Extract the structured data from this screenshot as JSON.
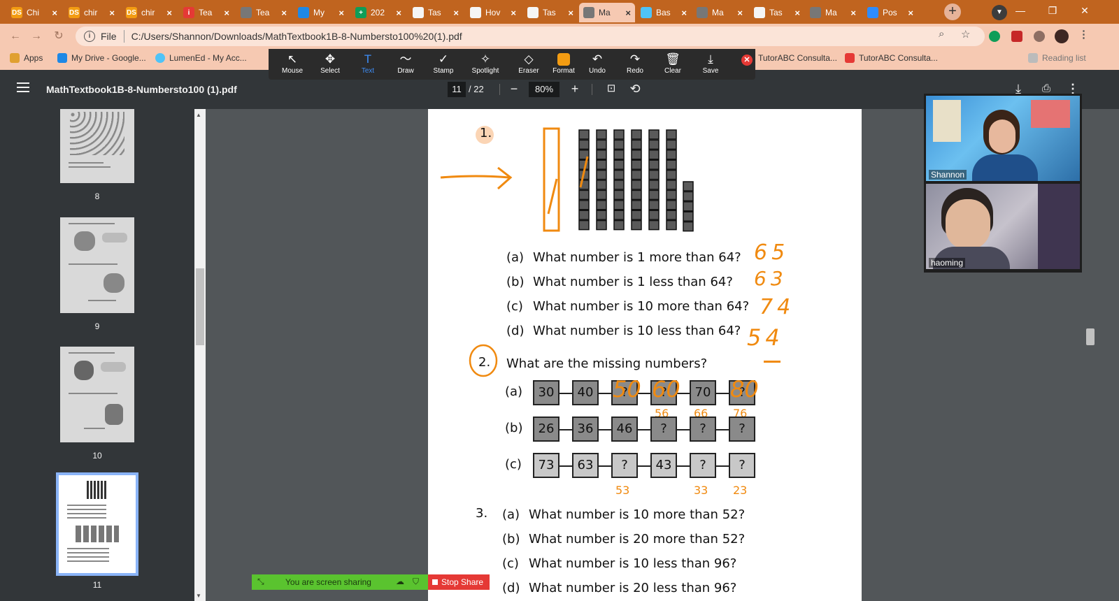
{
  "browser": {
    "tabs": [
      {
        "title": "Chi",
        "favicon_color": "#f39c12",
        "favicon": "DS",
        "active": false
      },
      {
        "title": "chir",
        "favicon_color": "#f39c12",
        "favicon": "DS",
        "active": false
      },
      {
        "title": "chir",
        "favicon_color": "#f39c12",
        "favicon": "DS",
        "active": false
      },
      {
        "title": "Tea",
        "favicon_color": "#e53935",
        "favicon": "i",
        "active": false
      },
      {
        "title": "Tea",
        "favicon_color": "#777777",
        "favicon": "",
        "active": false
      },
      {
        "title": "My",
        "favicon_color": "#1e88e5",
        "favicon": "",
        "active": false
      },
      {
        "title": "202",
        "favicon_color": "#0f9d58",
        "favicon": "+",
        "active": false
      },
      {
        "title": "Tas",
        "favicon_color": "#f5f5f5",
        "favicon": "",
        "active": false
      },
      {
        "title": "Hov",
        "favicon_color": "#f5f5f5",
        "favicon": "",
        "active": false
      },
      {
        "title": "Tas",
        "favicon_color": "#f5f5f5",
        "favicon": "",
        "active": false
      },
      {
        "title": "Ma",
        "favicon_color": "#777777",
        "favicon": "",
        "active": true
      },
      {
        "title": "Bas",
        "favicon_color": "#4fc3f7",
        "favicon": "",
        "active": false
      },
      {
        "title": "Ma",
        "favicon_color": "#777777",
        "favicon": "",
        "active": false
      },
      {
        "title": "Tas",
        "favicon_color": "#f5f5f5",
        "favicon": "",
        "active": false
      },
      {
        "title": "Ma",
        "favicon_color": "#777777",
        "favicon": "",
        "active": false
      },
      {
        "title": "Pos",
        "favicon_color": "#2d8cff",
        "favicon": "",
        "active": false
      }
    ],
    "url_scheme": "File",
    "url": "C:/Users/Shannon/Downloads/MathTextbook1B-8-Numbersto100%20(1).pdf",
    "bookmarks": [
      {
        "label": "Apps",
        "color": "#e0a030"
      },
      {
        "label": "My Drive - Google...",
        "color": "#1e88e5"
      },
      {
        "label": "LumenEd - My Acc...",
        "color": "#4fc3f7"
      },
      {
        "label": "TutorABC Consulta...",
        "color": "#e53935"
      },
      {
        "label": "TutorABC Consulta...",
        "color": "#e53935"
      },
      {
        "label": "Reading list",
        "color": "#999999"
      }
    ]
  },
  "annotation_toolbar": {
    "tools": [
      {
        "label": "Mouse",
        "icon": "↖"
      },
      {
        "label": "Select",
        "icon": "✥"
      },
      {
        "label": "Text",
        "icon": "T"
      },
      {
        "label": "Draw",
        "icon": "〜"
      },
      {
        "label": "Stamp",
        "icon": "✓"
      },
      {
        "label": "Spotlight",
        "icon": "✧"
      },
      {
        "label": "Eraser",
        "icon": "◇"
      },
      {
        "label": "Format",
        "icon": "■"
      },
      {
        "label": "Undo",
        "icon": "↶"
      },
      {
        "label": "Redo",
        "icon": "↷"
      },
      {
        "label": "Clear",
        "icon": "🗑"
      },
      {
        "label": "Save",
        "icon": "⤓"
      }
    ],
    "format_color": "#f39c12",
    "selected_tool": "Text"
  },
  "pdf_viewer": {
    "document_name": "MathTextbook1B-8-Numbersto100 (1).pdf",
    "current_page": "11",
    "total_pages": "/ 22",
    "zoom": "80%",
    "thumbnails": [
      {
        "page": "8"
      },
      {
        "page": "9"
      },
      {
        "page": "10"
      },
      {
        "page": "11"
      }
    ]
  },
  "page_content": {
    "q1_number": "1.",
    "q1_items": [
      {
        "letter": "(a)",
        "text": "What number is 1 more than 64?",
        "answer": "65"
      },
      {
        "letter": "(b)",
        "text": "What number is 1 less than 64?",
        "answer": "63"
      },
      {
        "letter": "(c)",
        "text": "What number is 10 more than 64?",
        "answer": "74"
      },
      {
        "letter": "(d)",
        "text": "What number is 10 less than 64?",
        "answer": "54"
      }
    ],
    "q2_number": "2.",
    "q2_text": "What are the missing numbers?",
    "q2_rows": [
      {
        "letter": "(a)",
        "boxes": [
          "30",
          "40",
          "?",
          "?",
          "70",
          "?"
        ],
        "handwritten": [
          "",
          "",
          "50",
          "60",
          "",
          "80"
        ],
        "below": [
          "",
          "",
          "",
          "56",
          "66",
          "76"
        ]
      },
      {
        "letter": "(b)",
        "boxes": [
          "26",
          "36",
          "46",
          "?",
          "?",
          "?"
        ],
        "handwritten": [
          "",
          "",
          "",
          "",
          "",
          ""
        ],
        "below": [
          "",
          "",
          "",
          "",
          "",
          ""
        ]
      },
      {
        "letter": "(c)",
        "boxes": [
          "73",
          "63",
          "?",
          "43",
          "?",
          "?"
        ],
        "handwritten": [
          "",
          "",
          "",
          "",
          "",
          ""
        ],
        "below": [
          "",
          "",
          "53",
          "",
          "33",
          "23"
        ]
      }
    ],
    "q3_number": "3.",
    "q3_items": [
      {
        "letter": "(a)",
        "text": "What number is 10 more than 52?"
      },
      {
        "letter": "(b)",
        "text": "What number is 20 more than 52?"
      },
      {
        "letter": "(c)",
        "text": "What number is 10 less than 96?"
      },
      {
        "letter": "(d)",
        "text": "What number is 20 less than 96?"
      }
    ],
    "ink_color": "#f08a10"
  },
  "video": {
    "participants": [
      {
        "name": "Shannon"
      },
      {
        "name": "haoming"
      }
    ]
  },
  "screen_share": {
    "status": "You are screen sharing",
    "stop_label": "Stop Share"
  }
}
